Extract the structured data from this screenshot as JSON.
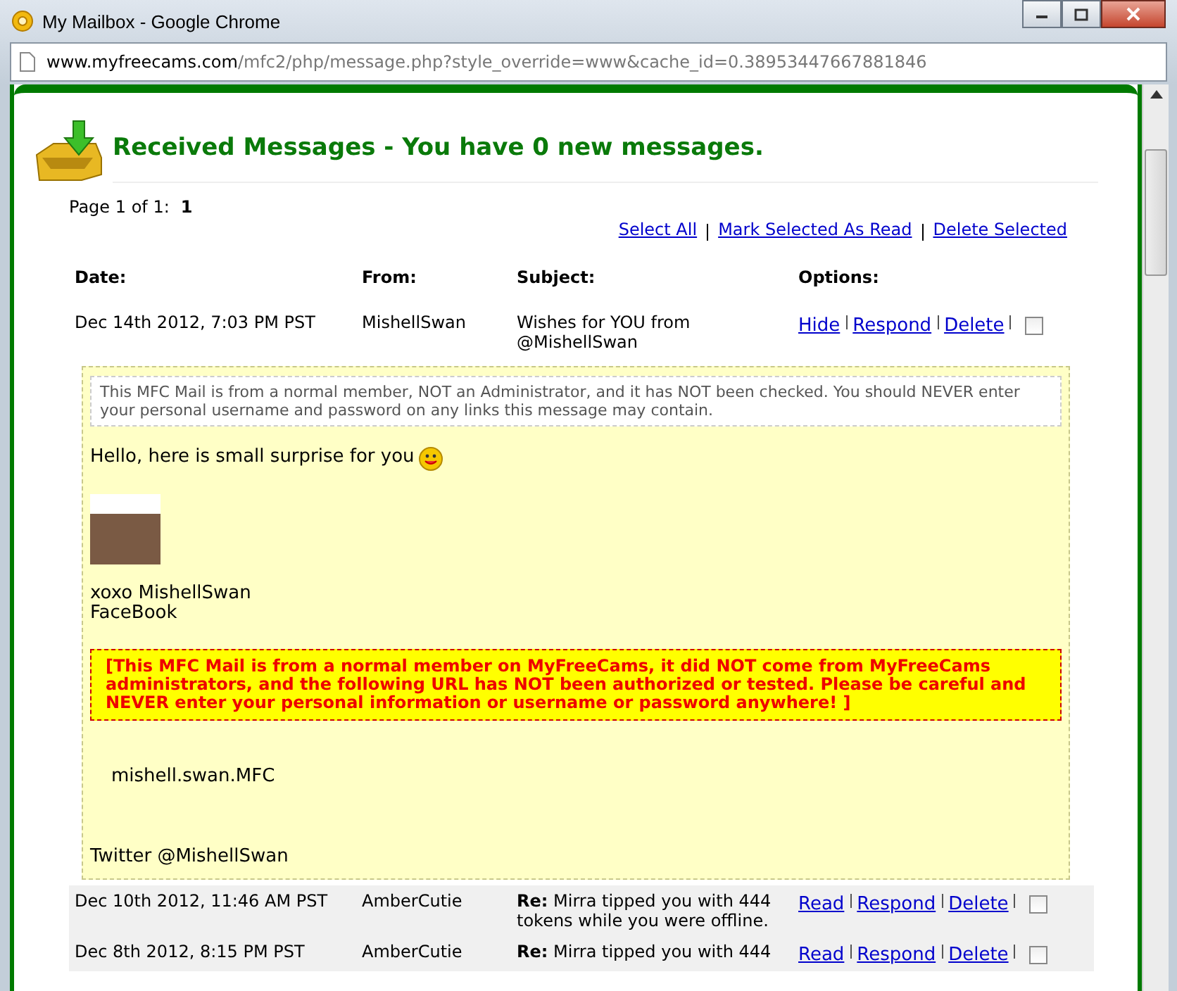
{
  "window": {
    "title": "My Mailbox - Google Chrome"
  },
  "address_bar": {
    "domain": "www.myfreecams.com",
    "path": "/mfc2/php/message.php?style_override=www&cache_id=0.38953447667881846"
  },
  "heading": "Received Messages - You have 0 new messages.",
  "pager": {
    "label": "Page 1 of 1:",
    "pages": [
      {
        "label": "1",
        "selected": true
      }
    ]
  },
  "bulk_actions": [
    "Select All",
    "Mark Selected As Read",
    "Delete Selected"
  ],
  "table": {
    "columns": [
      "Date:",
      "From:",
      "Subject:",
      "Options:"
    ],
    "rows": [
      {
        "date": "Dec 14th 2012, 7:03 PM PST",
        "from": "MishellSwan",
        "subject": "Wishes for YOU from @MishellSwan",
        "actions": [
          "Hide",
          "Respond",
          "Delete"
        ],
        "checked": false,
        "expanded": true,
        "body": [
          {
            "kind": "notice",
            "text": "This MFC Mail is from a normal member, NOT an Administrator, and it has NOT been checked. You should NEVER enter your personal username and password on any links this message may contain."
          },
          {
            "kind": "smile",
            "text": "Hello, here is small surprise for you"
          },
          {
            "kind": "photo"
          },
          {
            "kind": "text",
            "text": "xoxo MishellSwan"
          },
          {
            "kind": "text",
            "text": "FaceBook"
          },
          {
            "kind": "warning",
            "text": "[This MFC Mail is from a normal member on MyFreeCams, it did NOT come from MyFreeCams administrators, and the following URL has NOT been authorized or tested. Please be careful and NEVER enter your personal information or username or password anywhere! ]"
          },
          {
            "kind": "url",
            "text": "mishell.swan.MFC"
          },
          {
            "kind": "footer",
            "text": "Twitter @MishellSwan"
          }
        ]
      },
      {
        "date": "Dec 10th 2012, 11:46 AM PST",
        "from": "AmberCutie",
        "subject": "**Re:** Mirra tipped you with 444 tokens while you were offline.",
        "actions": [
          "Read",
          "Respond",
          "Delete"
        ],
        "checked": false,
        "expanded": false
      },
      {
        "date": "Dec 8th 2012, 8:15 PM PST",
        "from": "AmberCutie",
        "subject": "**Re:** Mirra tipped you with 444",
        "actions": [
          "Read",
          "Respond",
          "Delete"
        ],
        "checked": false,
        "expanded": false
      }
    ]
  }
}
